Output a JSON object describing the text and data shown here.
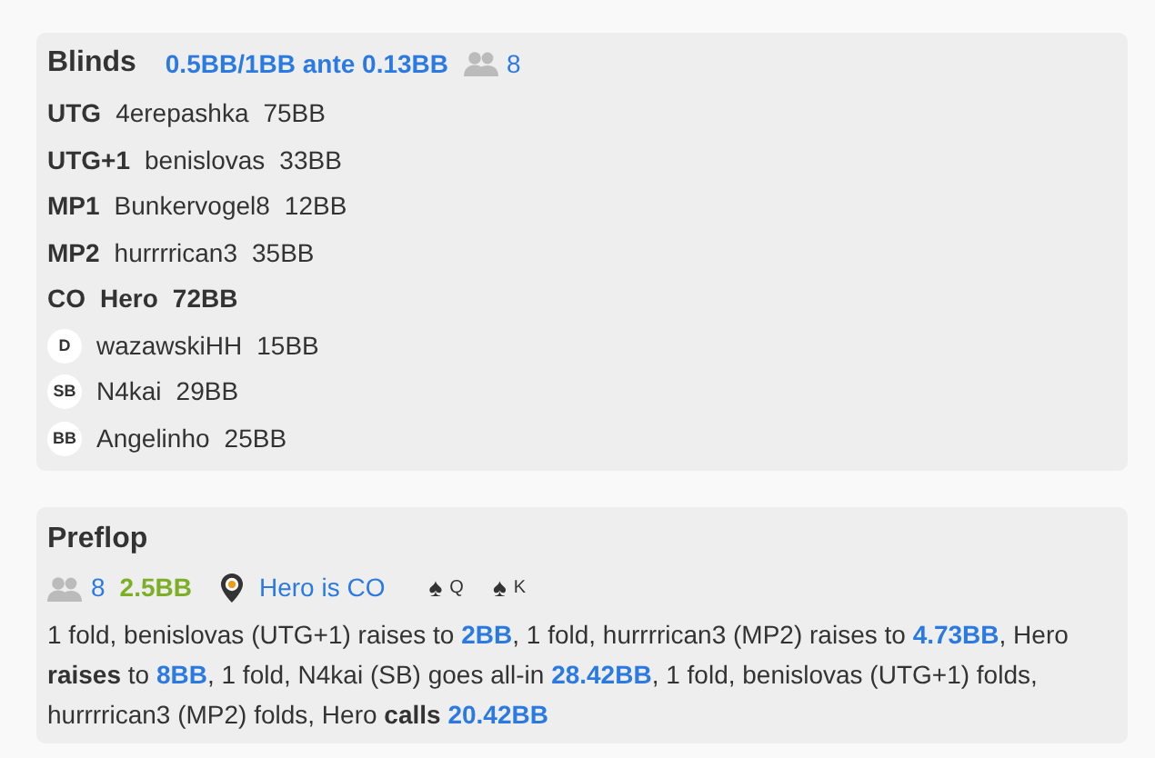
{
  "blinds": {
    "title": "Blinds",
    "stakes": "0.5BB/1BB ante 0.13BB",
    "players_count": "8",
    "players": [
      {
        "kind": "position",
        "position": "UTG",
        "name": "4erepashka",
        "stack": "75BB",
        "hero": false
      },
      {
        "kind": "position",
        "position": "UTG+1",
        "name": "benislovas",
        "stack": "33BB",
        "hero": false
      },
      {
        "kind": "position",
        "position": "MP1",
        "name": "Bunkervogel8",
        "stack": "12BB",
        "hero": false
      },
      {
        "kind": "position",
        "position": "MP2",
        "name": "hurrrrican3",
        "stack": "35BB",
        "hero": false
      },
      {
        "kind": "position",
        "position": "CO",
        "name": "Hero",
        "stack": "72BB",
        "hero": true
      },
      {
        "kind": "badge",
        "position": "D",
        "name": "wazawskiHH",
        "stack": "15BB",
        "hero": false
      },
      {
        "kind": "badge",
        "position": "SB",
        "name": "N4kai",
        "stack": "29BB",
        "hero": false
      },
      {
        "kind": "badge",
        "position": "BB",
        "name": "Angelinho",
        "stack": "25BB",
        "hero": false
      }
    ]
  },
  "preflop": {
    "title": "Preflop",
    "players_count": "8",
    "pot": "2.5BB",
    "hero_position": "Hero is CO",
    "cards": [
      {
        "suit": "♠",
        "rank": "Q"
      },
      {
        "suit": "♠",
        "rank": "K"
      }
    ],
    "actions": [
      {
        "kind": "text",
        "text": "1 fold, benislovas (UTG+1) raises to "
      },
      {
        "kind": "amount",
        "text": "2BB"
      },
      {
        "kind": "text",
        "text": ", 1 fold, hurrrrican3 (MP2) raises to "
      },
      {
        "kind": "amount",
        "text": "4.73BB"
      },
      {
        "kind": "text",
        "text": ", Hero "
      },
      {
        "kind": "verb",
        "text": "raises"
      },
      {
        "kind": "text",
        "text": " to "
      },
      {
        "kind": "amount",
        "text": "8BB"
      },
      {
        "kind": "text",
        "text": ", 1 fold, N4kai (SB) goes all-in "
      },
      {
        "kind": "amount",
        "text": "28.42BB"
      },
      {
        "kind": "text",
        "text": ", 1 fold, benislovas (UTG+1) folds, hurrrrican3 (MP2) folds, Hero "
      },
      {
        "kind": "verb",
        "text": "calls"
      },
      {
        "kind": "amount",
        "text": "20.42BB"
      }
    ]
  }
}
